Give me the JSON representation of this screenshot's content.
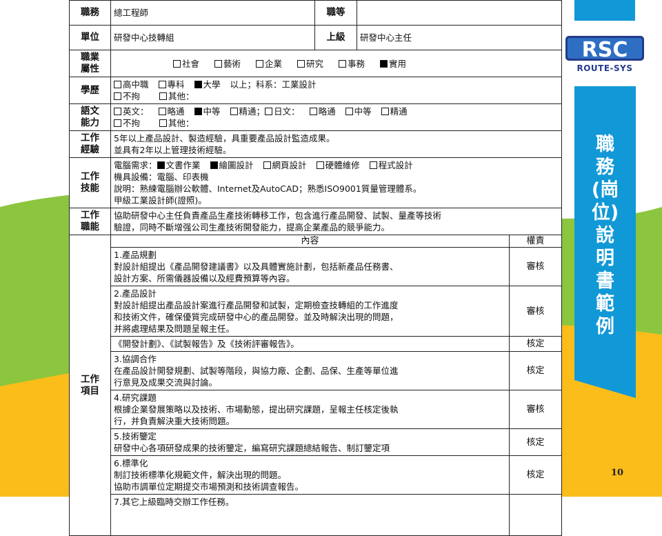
{
  "header_rows": {
    "position_label": "職務",
    "position_value": "總工程師",
    "rank_label": "職等",
    "rank_value": "",
    "unit_label": "單位",
    "unit_value": "研發中心技轉組",
    "supervisor_label": "上級",
    "supervisor_value": "研發中心主任"
  },
  "attribute": {
    "label_1": "職業",
    "label_2": "屬性",
    "options": [
      {
        "label": "社會",
        "checked": false
      },
      {
        "label": "藝術",
        "checked": false
      },
      {
        "label": "企業",
        "checked": false
      },
      {
        "label": "研究",
        "checked": false
      },
      {
        "label": "事務",
        "checked": false
      },
      {
        "label": "實用",
        "checked": true
      }
    ]
  },
  "education": {
    "label": "學歷",
    "opt_1": "高中職",
    "opt_2": "專科",
    "opt_3": "大學",
    "opt_3_suffix": "以上；科系：工業設計",
    "opt_4": "不拘",
    "opt_5": "其他："
  },
  "language": {
    "label_1": "語文",
    "label_2": "能力",
    "english": "英文：",
    "e1": "略通",
    "e2": "中等",
    "e3": "精通；",
    "japanese": "日文：",
    "j1": "略通",
    "j2": "中等",
    "j3": "精通",
    "other_1": "不拘",
    "other_2": "其他："
  },
  "experience": {
    "label_1": "工作",
    "label_2": "經驗",
    "line_1": "5年以上產品設計、製造經驗，具重要產品設計監造成果。",
    "line_2": "並具有2年以上管理技術經驗。"
  },
  "skills": {
    "label_1": "工作",
    "label_2": "技能",
    "computer_prefix": "電腦需求：",
    "c1": "文書作業",
    "c2": "繪圖設計",
    "c3": "網頁設計",
    "c4": "硬體維修",
    "c5": "程式設計",
    "line_2": "機具設備：電腦、印表機",
    "line_3": "說明：熟練電腦辦公軟體、Internet及AutoCAD；熟悉ISO9001質量管理體系。",
    "line_4": "甲級工業設計師(證照)。"
  },
  "function": {
    "label_1": "工作",
    "label_2": "職能",
    "line_1": "協助研發中心主任負責產品生產技術轉移工作，包含進行產品開發、試製、量產等技術",
    "line_2": "驗證，同時不斷增强公司生產技術開發能力，提高企業產品的競爭能力。"
  },
  "items": {
    "label_1": "工作",
    "label_2": "項目",
    "content_header": "內容",
    "authority_header": "權責",
    "list": [
      {
        "title": "1.產品規劃",
        "lines": [
          "對設計組提出《產品開發建議書》以及具體實施計劃，包括新產品任務書、",
          "設計方案、所需儀器設備以及經費預算等內容。"
        ],
        "authority": "審核"
      },
      {
        "title": "2.產品設計",
        "lines": [
          "對設計組提出產品設計案進行產品開發和試製，定期檢查技轉組的工作進度",
          "和技術文件，確保優質完成研發中心的產品開發。並及時解決出現的問題，",
          "并將處理結果及問題呈報主任。"
        ],
        "authority": "審核"
      },
      {
        "title": "",
        "lines": [
          "《開發計劃》、《試製報告》及《技術評審報告》。"
        ],
        "authority": "核定"
      },
      {
        "title": "3.協調合作",
        "lines": [
          "在產品設計開發規劃、試製等階段，與協力廠、企劃、品保、生產等單位進",
          "行意見及成果交流與討論。"
        ],
        "authority": "核定"
      },
      {
        "title": "4.研究課題",
        "lines": [
          "根據企業發展策略以及技術、市場動態，提出研究課題，呈報主任核定後執",
          "行，并負責解決重大技術問題。"
        ],
        "authority": "審核"
      },
      {
        "title": "5.技術鑒定",
        "lines": [
          "研發中心各項研發成果的技術鑒定，編寫研究課題總結報告、制訂鑒定項"
        ],
        "authority": "核定"
      },
      {
        "title": "6.標準化",
        "lines": [
          "制訂技術標準化規範文件，解決出現的問題。",
          "協助市調單位定期提交市場預測和技術調查報告。"
        ],
        "authority": "核定"
      },
      {
        "title": "7.其它上級臨時交辦工作任務。",
        "lines": [],
        "authority": ""
      }
    ]
  },
  "sidebar": {
    "logo_text": "ROUTE-SYS",
    "logo_letters": "RSC",
    "title_chars": [
      "職",
      "務",
      "(崗",
      "位)",
      "說",
      "明",
      "書",
      "範",
      "例"
    ],
    "page_number": "10"
  },
  "colors": {
    "accent_blue": "#1198d6",
    "green_wave": "#8cc63f",
    "yellow_wave": "#fbbd1a",
    "logo_blue": "#233a8c"
  }
}
